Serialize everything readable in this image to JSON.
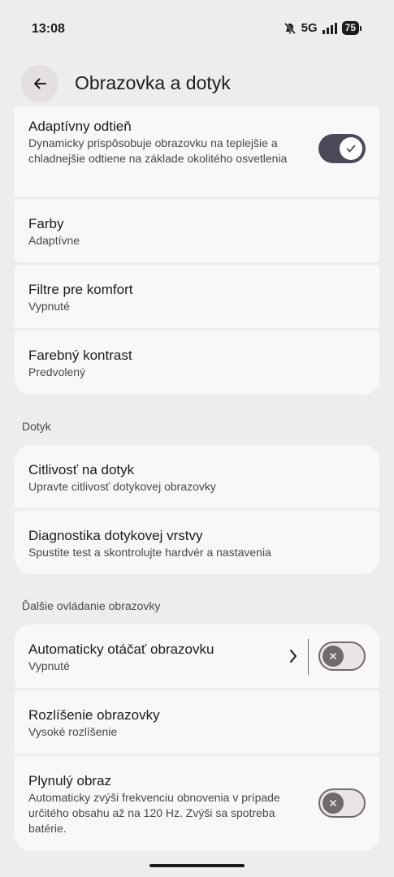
{
  "status": {
    "time": "13:08",
    "network": "5G",
    "battery": "75"
  },
  "header": {
    "title": "Obrazovka a dotyk"
  },
  "display_items": [
    {
      "title": "Adaptívny odtieň",
      "subtitle": "Dynamicky prispôsobuje obrazovku na teplejšie a chladnejšie odtiene na základe okolitého osvetlenia",
      "toggle": true
    },
    {
      "title": "Farby",
      "subtitle": "Adaptívne"
    },
    {
      "title": "Filtre pre komfort",
      "subtitle": "Vypnuté"
    },
    {
      "title": "Farebný kontrast",
      "subtitle": "Predvolený"
    }
  ],
  "touch_section": {
    "label": "Dotyk",
    "items": [
      {
        "title": "Citlivosť na dotyk",
        "subtitle": "Upravte citlivosť dotykovej obrazovky"
      },
      {
        "title": "Diagnostika dotykovej vrstvy",
        "subtitle": "Spustite test a skontrolujte hardvér a nastavenia"
      }
    ]
  },
  "more_section": {
    "label": "Ďalšie ovládanie obrazovky",
    "items": [
      {
        "title": "Automaticky otáčať obrazovku",
        "subtitle": "Vypnuté",
        "toggle": false
      },
      {
        "title": "Rozlíšenie obrazovky",
        "subtitle": "Vysoké rozlíšenie"
      },
      {
        "title": "Plynulý obraz",
        "subtitle": "Automaticky zvýši frekvenciu obnovenia v prípade určitého obsahu až na 120 Hz. Zvýši sa spotreba batérie.",
        "toggle": false
      }
    ]
  },
  "colors": {
    "background": "#efecef",
    "card": "#faf7f9",
    "toggle_on": "#4a4a58",
    "toggle_off_thumb": "#6e6a6e"
  }
}
